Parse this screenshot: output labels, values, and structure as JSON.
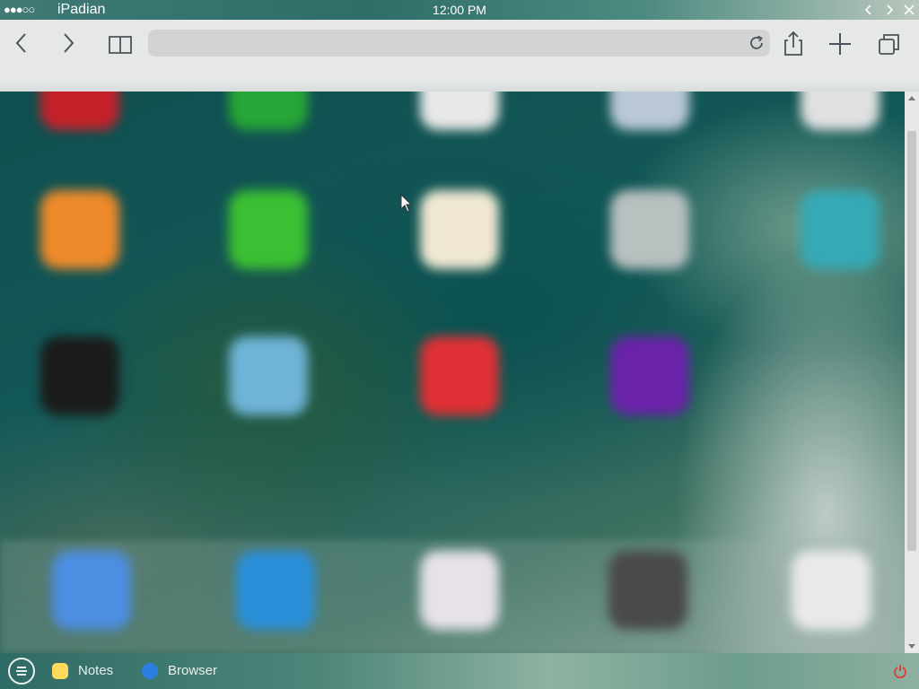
{
  "status_bar": {
    "signal": "●●●○○",
    "carrier": "iPadian",
    "time": "12:00 PM"
  },
  "window_controls": [
    "back",
    "forward",
    "close"
  ],
  "browser": {
    "url_placeholder": "",
    "url_value": "",
    "toolbar_icons": [
      "back-icon",
      "forward-icon",
      "bookmarks-icon",
      "reload-icon",
      "share-icon",
      "add-tab-icon",
      "tabs-icon"
    ]
  },
  "background_apps": {
    "rows": [
      [
        "#c4212a",
        "#27a536",
        "#e8e8e8",
        "#b9c8d4",
        "#e0e0e0"
      ],
      [
        "#ee8a2a",
        "#3bbf33",
        "#efe7d2",
        "#b8c0c0",
        "#35a9b4"
      ],
      [
        "#1b1b1b",
        "#6fb3d6",
        "#df3035",
        "#6a22a8"
      ]
    ],
    "dock": [
      "#4c8ee2",
      "#2a8fd9",
      "#e6e2e8",
      "#4a4a4a",
      "#e9e9e9"
    ]
  },
  "taskbar": {
    "items": [
      {
        "label": "Notes",
        "color": "#ffd95a"
      },
      {
        "label": "Browser",
        "color": "#2c7fe0"
      }
    ],
    "power_color": "#e8322b"
  }
}
